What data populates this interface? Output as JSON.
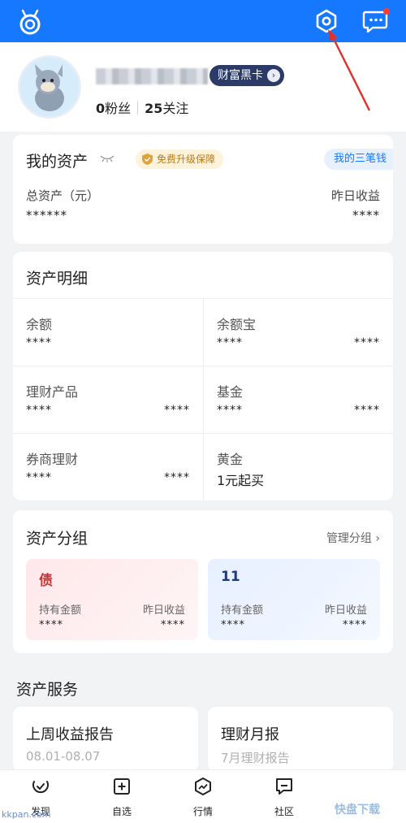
{
  "profile": {
    "badge": "财富黑卡",
    "fans_count": "0",
    "fans_label": "粉丝",
    "follow_count": "25",
    "follow_label": "关注"
  },
  "assets": {
    "title": "我的资产",
    "upgrade_label": "免费升级保障",
    "three_label": "我的三笔钱",
    "total_label": "总资产（元）",
    "total_value": "******",
    "yesterday_label": "昨日收益",
    "yesterday_value": "****"
  },
  "detail": {
    "title": "资产明细",
    "items": [
      {
        "name": "余额",
        "v1": "****",
        "v2": ""
      },
      {
        "name": "余额宝",
        "v1": "****",
        "v2": "****"
      },
      {
        "name": "理财产品",
        "v1": "****",
        "v2": "****"
      },
      {
        "name": "基金",
        "v1": "****",
        "v2": "****"
      },
      {
        "name": "券商理财",
        "v1": "****",
        "v2": "****"
      },
      {
        "name": "黄金",
        "v1": "1元起买",
        "v2": ""
      }
    ]
  },
  "groups": {
    "title": "资产分组",
    "manage_label": "管理分组",
    "items": [
      {
        "name": "债",
        "hold_label": "持有金额",
        "hold_value": "****",
        "yday_label": "昨日收益",
        "yday_value": "****"
      },
      {
        "name": "11",
        "hold_label": "持有金额",
        "hold_value": "****",
        "yday_label": "昨日收益",
        "yday_value": "****"
      }
    ]
  },
  "services": {
    "title": "资产服务",
    "items": [
      {
        "title": "上周收益报告",
        "subtitle": "08.01-08.07"
      },
      {
        "title": "理财月报",
        "subtitle": "7月理财报告"
      }
    ]
  },
  "nav": {
    "items": [
      {
        "label": "发现",
        "icon": "discover-icon"
      },
      {
        "label": "自选",
        "icon": "watchlist-icon"
      },
      {
        "label": "行情",
        "icon": "market-icon"
      },
      {
        "label": "社区",
        "icon": "community-icon"
      }
    ]
  },
  "watermark": {
    "left": "kkpan.com",
    "right": "快盘下载"
  },
  "colors": {
    "brand_blue": "#1677ff",
    "annotation_red": "#e0322b"
  }
}
